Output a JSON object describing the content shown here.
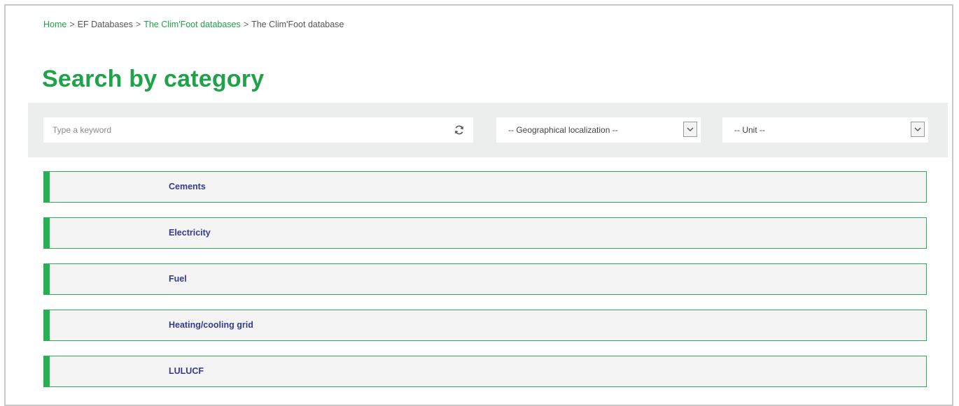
{
  "breadcrumb": {
    "items": [
      {
        "label": "Home",
        "link": true
      },
      {
        "label": "EF Databases",
        "link": false
      },
      {
        "label": "The Clim'Foot databases",
        "link": true
      },
      {
        "label": "The Clim'Foot database",
        "link": false
      }
    ],
    "separator": ">"
  },
  "page": {
    "title": "Search by category"
  },
  "search": {
    "keyword_placeholder": "Type a keyword",
    "keyword_value": "",
    "geo_select": "-- Geographical localization --",
    "unit_select": "-- Unit --"
  },
  "categories": [
    {
      "label": "Cements"
    },
    {
      "label": "Electricity"
    },
    {
      "label": "Fuel"
    },
    {
      "label": "Heating/cooling grid"
    },
    {
      "label": "LULUCF"
    }
  ],
  "colors": {
    "accent": "#1fa34a",
    "category_text": "#343b8c",
    "panel_bg": "#eceeed"
  },
  "icons": {
    "refresh": "refresh-icon",
    "dropdown": "chevron-down-icon"
  }
}
